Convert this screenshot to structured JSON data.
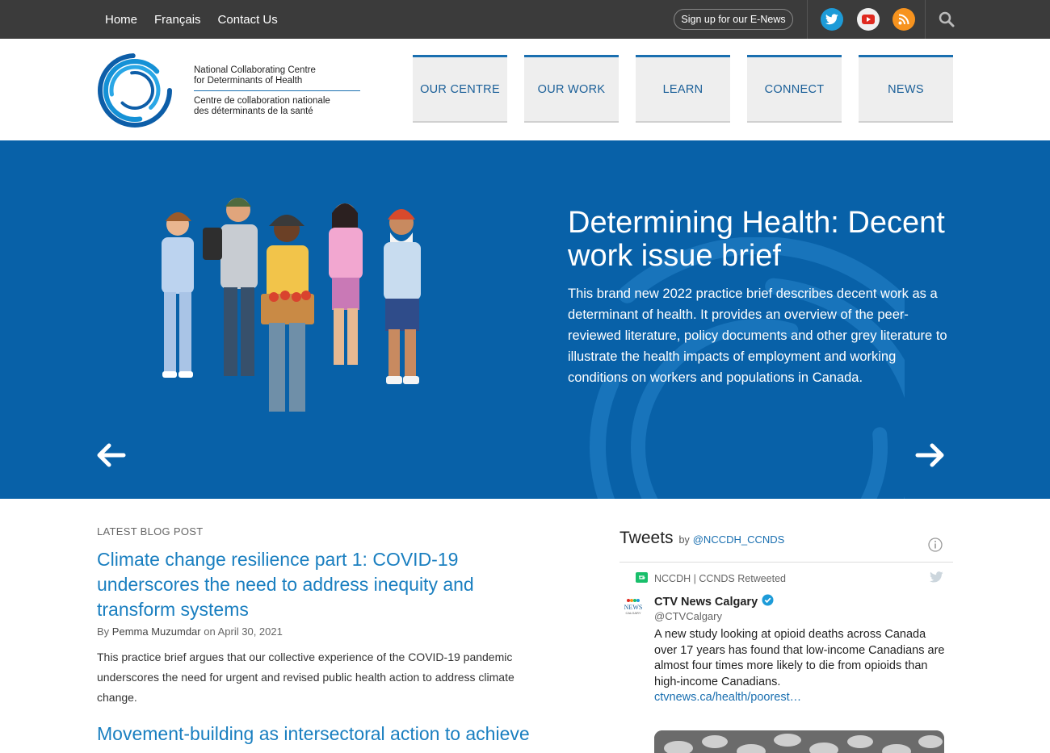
{
  "topbar": {
    "nav": [
      "Home",
      "Français",
      "Contact Us"
    ],
    "enews_label": "Sign up for our E-News",
    "colors": {
      "bg": "#3b3b3b",
      "twitter": "#1d9bd8",
      "youtube": "#e02a20",
      "rss": "#f7931e"
    }
  },
  "header": {
    "logo_en_line1": "National Collaborating Centre",
    "logo_en_line2": "for Determinants of Health",
    "logo_fr_line1": "Centre de collaboration nationale",
    "logo_fr_line2": "des déterminants de la santé",
    "nav": [
      "OUR CENTRE",
      "OUR WORK",
      "LEARN",
      "CONNECT",
      "NEWS"
    ]
  },
  "hero": {
    "title": "Determining Health: Decent work issue brief",
    "description": "This brand new 2022 practice brief describes decent work as a determinant of health. It provides an overview of the peer-reviewed literature, policy documents and other grey literature to illustrate the health impacts of employment and working conditions on workers and populations in Canada.",
    "bg_color": "#0861a8"
  },
  "blog": {
    "label": "LATEST BLOG POST",
    "title": "Climate change resilience part 1: COVID-19 underscores the need to address inequity and transform systems",
    "by": "By",
    "author": "Pemma Muzumdar",
    "on": "on",
    "date": "April 30, 2021",
    "excerpt": "This practice brief argues that our collective experience of the COVID-19 pandemic underscores the need for urgent and revised public health action to address climate change.",
    "next_title": "Movement-building as intersectoral action to achieve"
  },
  "tweets": {
    "title": "Tweets",
    "by": "by",
    "handle": "@NCCDH_CCNDS",
    "retweet_label": "NCCDH | CCNDS Retweeted",
    "tweet": {
      "name": "CTV News Calgary",
      "handle": "@CTVCalgary",
      "avatar_text": "NEWS",
      "avatar_sub": "CALGARY",
      "text": "A new study looking at opioid deaths across Canada over 17 years has found that low-income Canadians are almost four times more likely to die from opioids than high-income Canadians.",
      "link": "ctvnews.ca/health/poorest…"
    }
  }
}
